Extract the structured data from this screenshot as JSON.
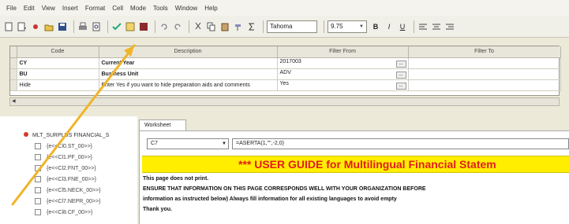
{
  "menu": [
    "File",
    "Edit",
    "View",
    "Insert",
    "Format",
    "Cell",
    "Mode",
    "Tools",
    "Window",
    "Help"
  ],
  "toolbar": {
    "font": "Tahoma",
    "size": "9.75",
    "bold": "B",
    "italic": "I",
    "underline": "U"
  },
  "filter_grid": {
    "columns": [
      "Code",
      "Description",
      "Filter From",
      "Filter To"
    ],
    "rows": [
      {
        "code": "CY",
        "description": "Current Year",
        "from": "2017003",
        "to": ""
      },
      {
        "code": "BU",
        "description": "Business Unit",
        "from": "ADV",
        "to": ""
      },
      {
        "code": "Hide",
        "description": "Enter Yes if you want to hide preparation aids and comments",
        "from": "Yes",
        "to": ""
      }
    ],
    "ellipsis": "..."
  },
  "tree": {
    "root": "MLT_SURPLUS FINANCIAL_S",
    "items": [
      "{e<<Cl0.ST_00>>}",
      "{e<<Cl1.PF_00>>}",
      "{e<<Cl2.FNT_00>>}",
      "{e<<Cl3.FNE_00>>}",
      "{e<<Cl5.NECK_00>>}",
      "{e<<Cl7.NEPR_00>>}",
      "{e<<Cl8.CF_00>>}"
    ]
  },
  "worksheet": {
    "tab": "Worksheet",
    "cell_ref": "C7",
    "formula": "=ASERTA(1,\"\",-2,0)",
    "banner": "*** USER GUIDE for Multilingual Financial Statem",
    "lines": [
      "This page does not print.",
      "ENSURE THAT INFORMATION ON THIS PAGE CORRESPONDS WELL WITH YOUR ORGANIZATION BEFORE",
      "information as instructed below) Always fill information for all existing languages to avoid empty",
      "Thank you."
    ]
  },
  "colors": {
    "banner_bg": "#ffee00",
    "banner_text": "#e21d1d",
    "arrow": "#f0b429"
  }
}
